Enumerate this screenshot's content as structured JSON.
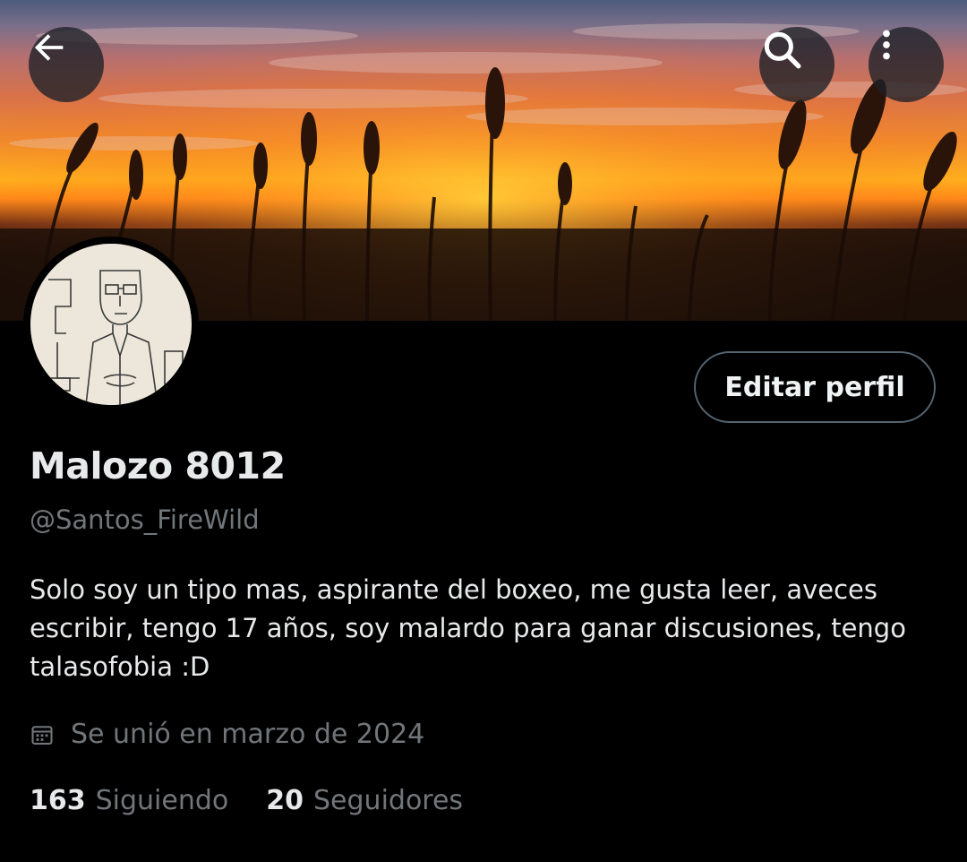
{
  "banner": {
    "image": "wheat field at sunset",
    "colors": [
      "#4c5c7c",
      "#d8724a",
      "#ffb21e",
      "#2b160c"
    ]
  },
  "top_bar": {
    "back_icon": "arrow-left-icon",
    "search_icon": "search-icon",
    "more_icon": "more-vertical-icon"
  },
  "profile": {
    "avatar": "sketch drawing of a man with glasses",
    "edit_button_label": "Editar perfil",
    "display_name": "Malozo 8012",
    "handle": "@Santos_FireWild",
    "bio": "Solo soy un tipo mas, aspirante del boxeo, me gusta leer, aveces escribir, tengo 17 años, soy malardo para ganar discusiones, tengo talasofobia :D",
    "joined_icon": "calendar-icon",
    "joined": "Se unió en marzo de 2024",
    "following_count": "163",
    "following_label": "Siguiendo",
    "followers_count": "20",
    "followers_label": "Seguidores"
  },
  "theme": {
    "background": "#000000",
    "text": "#e7e9ea",
    "muted": "#71767b",
    "border": "#536471"
  }
}
